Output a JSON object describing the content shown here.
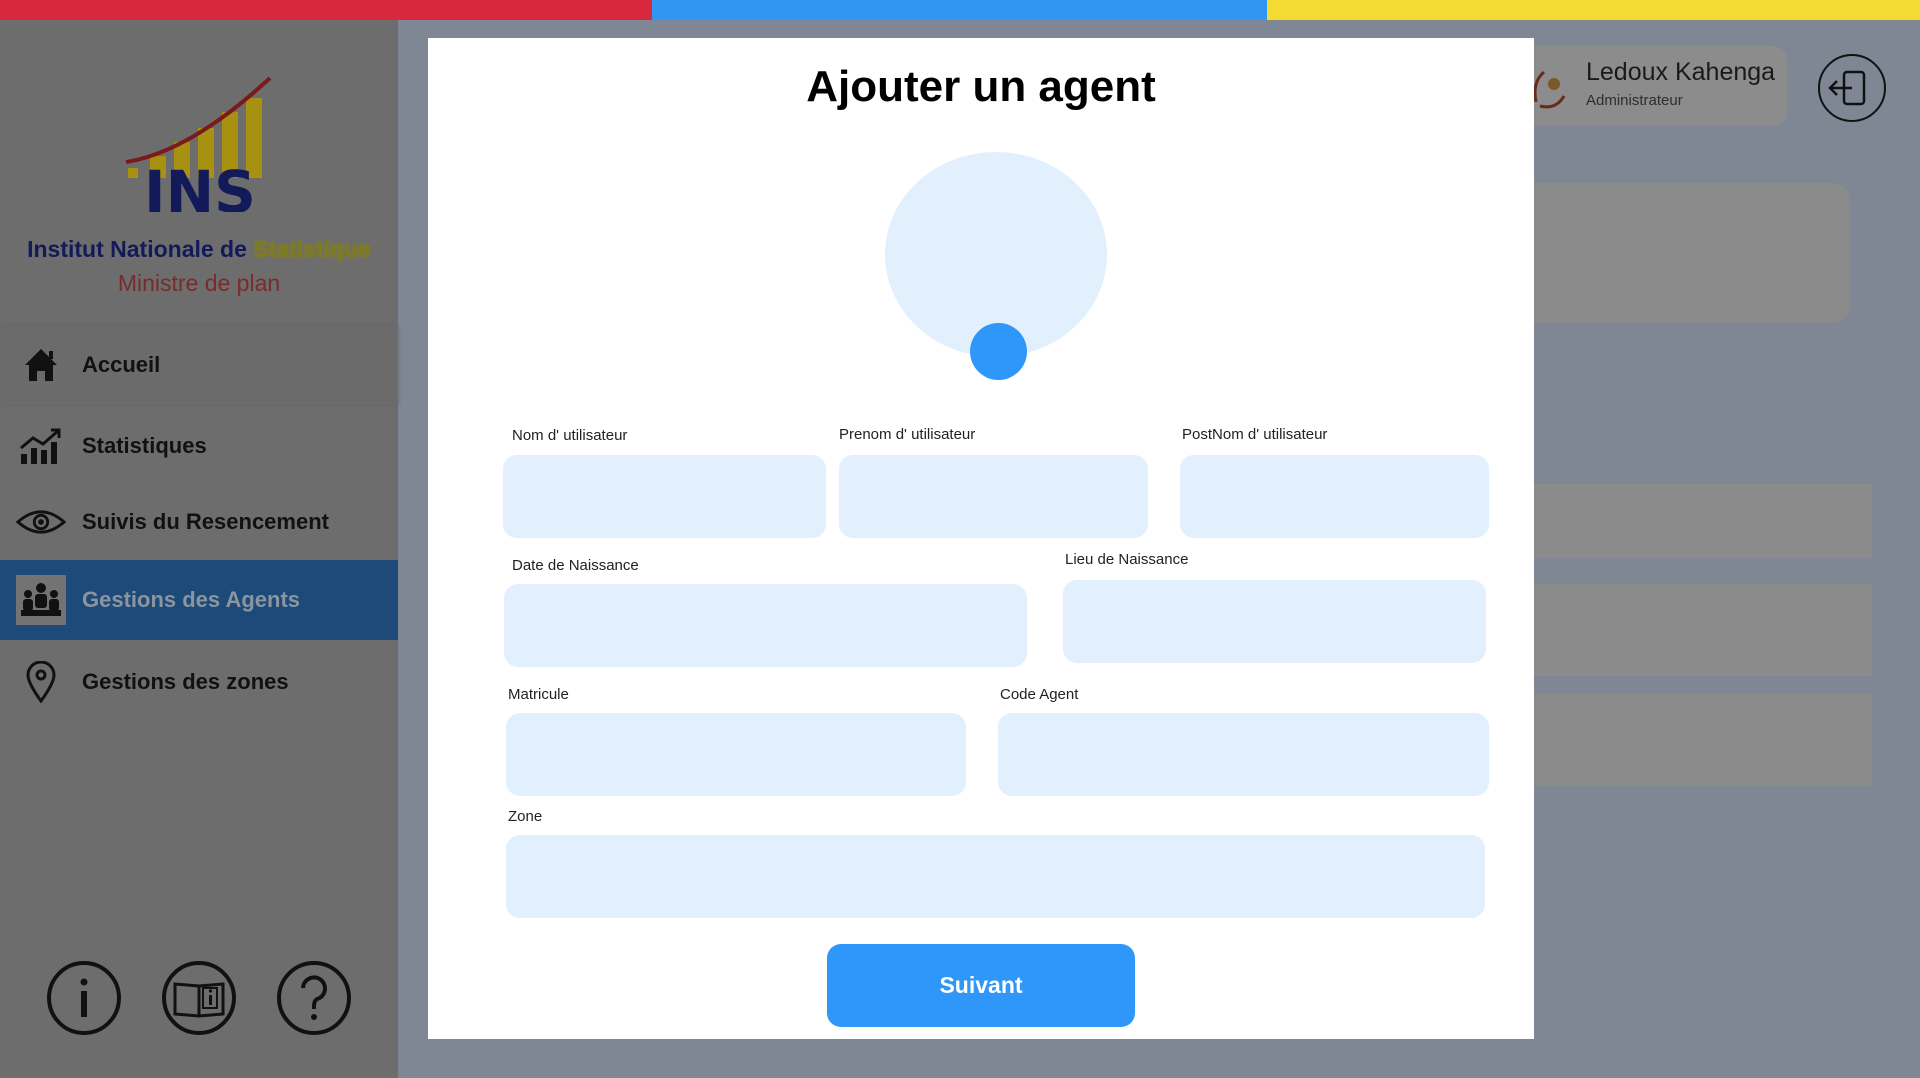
{
  "flag_colors": [
    "#d8283d",
    "#2f96f3",
    "#f4db34"
  ],
  "sidebar": {
    "logo_text": "INS",
    "org_name_part1": "Institut Nationale de ",
    "org_name_part2": "Statistique",
    "org_subtitle": "Ministre de plan",
    "items": [
      {
        "label": "Accueil",
        "icon": "home-icon"
      },
      {
        "label": "Statistiques",
        "icon": "chart-icon"
      },
      {
        "label": "Suivis du Resencement",
        "icon": "eye-icon"
      },
      {
        "label": "Gestions des Agents",
        "icon": "people-icon",
        "active": true
      },
      {
        "label": "Gestions des zones",
        "icon": "map-pin-icon"
      }
    ],
    "bottom_icons": [
      "info-icon",
      "book-info-icon",
      "help-icon"
    ]
  },
  "header": {
    "user_name": "Ledoux Kahenga",
    "user_role": "Administrateur",
    "logout_icon": "logout-icon"
  },
  "modal": {
    "title": "Ajouter un agent",
    "fields": {
      "nom": {
        "label": "Nom d' utilisateur",
        "value": ""
      },
      "prenom": {
        "label": "Prenom d' utilisateur",
        "value": ""
      },
      "postnom": {
        "label": "PostNom d' utilisateur",
        "value": ""
      },
      "date_naissance": {
        "label": "Date de Naissance",
        "value": ""
      },
      "lieu_naissance": {
        "label": "Lieu de Naissance",
        "value": ""
      },
      "matricule": {
        "label": "Matricule",
        "value": ""
      },
      "code_agent": {
        "label": "Code Agent",
        "value": ""
      },
      "zone": {
        "label": "Zone",
        "value": ""
      }
    },
    "submit_label": "Suivant"
  },
  "colors": {
    "accent": "#2f97f9",
    "input_bg": "#e2effc",
    "active_nav": "#1d4a78"
  }
}
